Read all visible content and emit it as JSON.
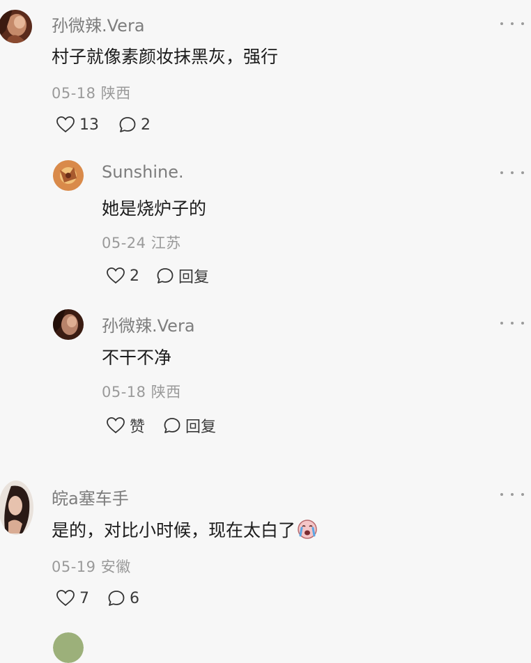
{
  "comments": [
    {
      "username": "孙微辣.Vera",
      "content": "村子就像素颜妆抹黑灰，强行",
      "date": "05-18",
      "location": "陕西",
      "like_label": "13",
      "reply_label": "2",
      "avatar_icon": "avatar-photo-icon",
      "replies": [
        {
          "username": "Sunshine.",
          "content": "她是烧炉子的",
          "date": "05-24",
          "location": "江苏",
          "like_label": "2",
          "reply_label": "回复"
        },
        {
          "username": "孙微辣.Vera",
          "content": "不干不净",
          "date": "05-18",
          "location": "陕西",
          "like_label": "赞",
          "reply_label": "回复"
        }
      ]
    },
    {
      "username": "皖a塞车手",
      "content": "是的，对比小时候，现在太白了",
      "content_emoji": "crying-face-icon",
      "date": "05-19",
      "location": "安徽",
      "like_label": "7",
      "reply_label": "6"
    }
  ],
  "colors": {
    "background": "#f7f7f7",
    "username": "#7d7d7d",
    "content": "#1c1c1c",
    "meta": "#9a9a9a"
  }
}
